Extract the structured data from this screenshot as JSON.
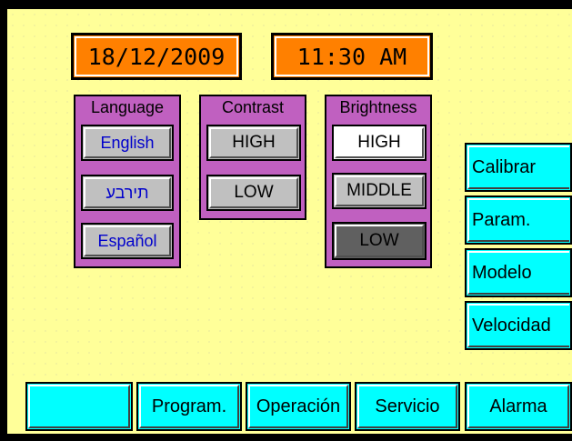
{
  "header": {
    "date": "18/12/2009",
    "time": "11:30 AM"
  },
  "language_panel": {
    "title": "Language",
    "options": [
      "English",
      "תירבע",
      "Español"
    ]
  },
  "contrast_panel": {
    "title": "Contrast",
    "options": [
      "HIGH",
      "LOW"
    ]
  },
  "brightness_panel": {
    "title": "Brightness",
    "options": [
      "HIGH",
      "MIDDLE",
      "LOW"
    ]
  },
  "side_menu": [
    "Calibrar",
    "Param.",
    "Modelo",
    "Velocidad"
  ],
  "bottom_nav": [
    "",
    "Program.",
    "Operación",
    "Servicio",
    "Alarma"
  ],
  "colors": {
    "background": "#ffff99",
    "lcd": "#ff8000",
    "panel": "#c060c0",
    "button_cyan": "#00ffff",
    "button_gray": "#c0c0c0"
  }
}
